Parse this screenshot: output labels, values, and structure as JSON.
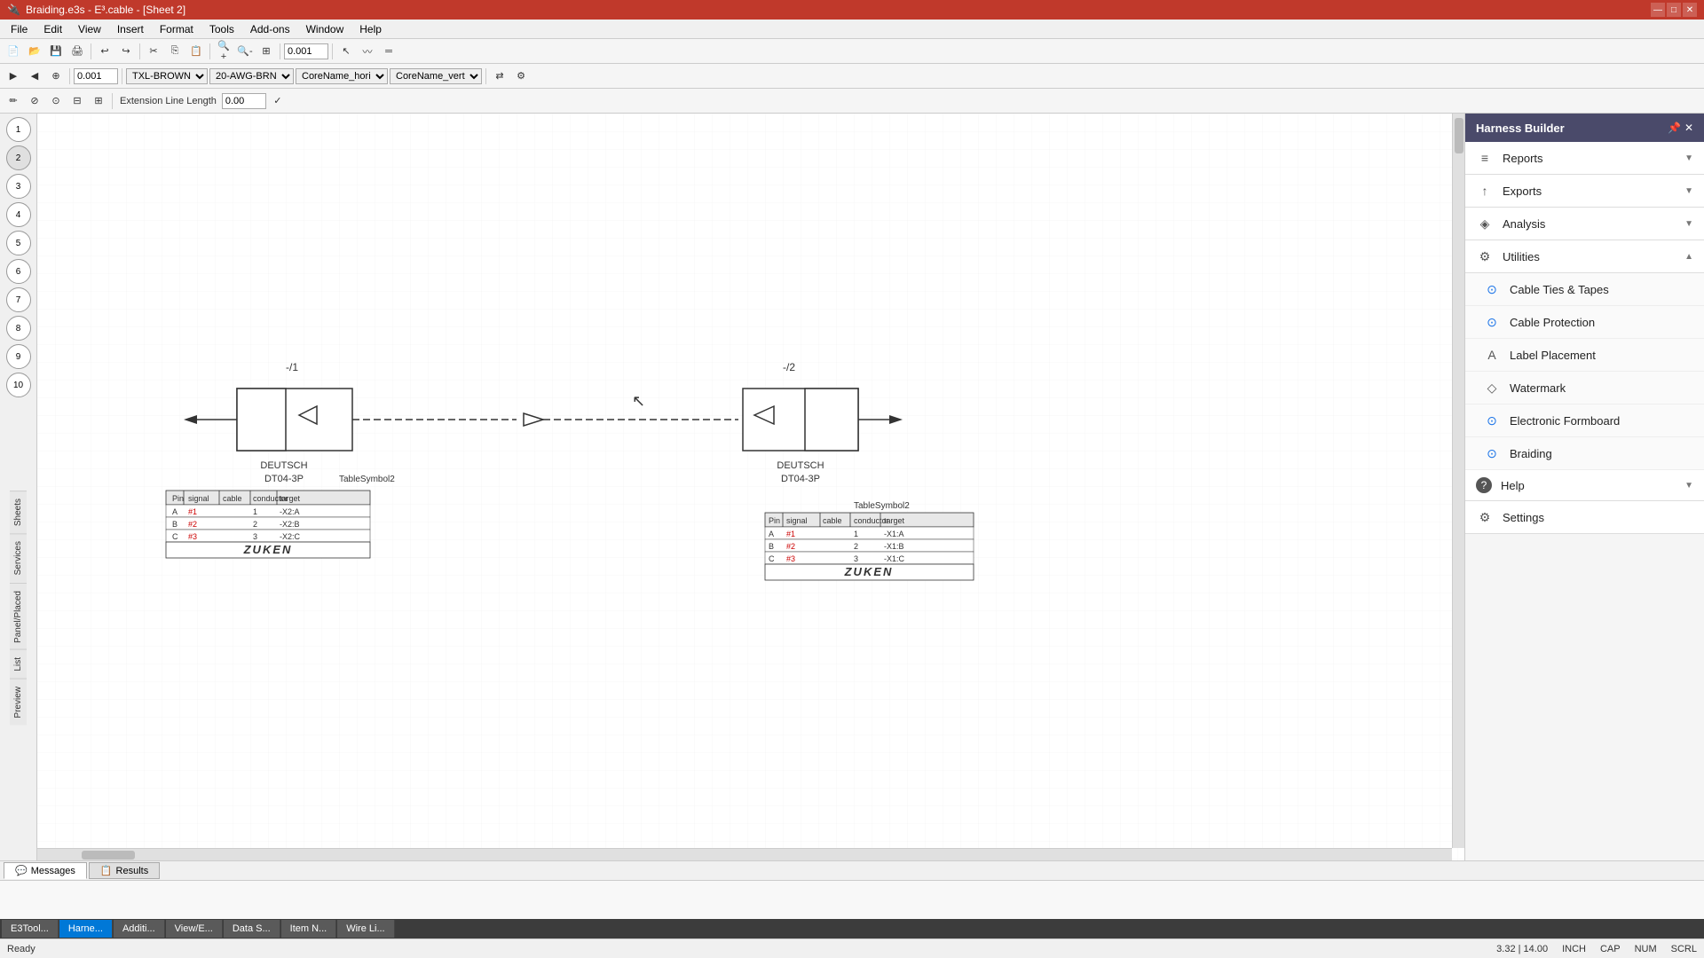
{
  "titleBar": {
    "title": "Braiding.e3s - E³.cable - [Sheet 2]",
    "controls": [
      "—",
      "□",
      "✕"
    ]
  },
  "appControls": [
    "▲",
    "✕"
  ],
  "menuBar": {
    "items": [
      "File",
      "Edit",
      "View",
      "Insert",
      "Format",
      "Tools",
      "Add-ons",
      "Window",
      "Help"
    ]
  },
  "toolbar1": {
    "items": []
  },
  "toolbar2": {
    "dropdowns": [
      "TXL-BROWN",
      "20-AWG-BRN",
      "CoreName_hori",
      "CoreName_vert"
    ]
  },
  "toolbar3": {
    "extensionLineLabel": "Extension Line Length",
    "extensionLineValue": "0.00"
  },
  "leftSidebar": {
    "tabs": [
      "Sheets",
      "Services",
      "Panel/Placed",
      "Panel Placed",
      "List",
      "Preview"
    ],
    "sheets": [
      "1",
      "2",
      "3",
      "4",
      "5",
      "6",
      "7",
      "8",
      "9",
      "10"
    ]
  },
  "canvas": {
    "connector1": {
      "label": "-/1",
      "name": "DEUTSCH",
      "model": "DT04-3P",
      "tableLabel": "TableSymbol2",
      "pins": [
        {
          "pin": "A",
          "signal": "#1",
          "cable": "",
          "conductor": "1",
          "target": "-X2:A"
        },
        {
          "pin": "B",
          "signal": "#2",
          "cable": "",
          "conductor": "2",
          "target": "-X2:B"
        },
        {
          "pin": "C",
          "signal": "#3",
          "cable": "",
          "conductor": "3",
          "target": "-X2:C"
        }
      ],
      "columns": [
        "Pin",
        "signal",
        "cable",
        "conductor",
        "target"
      ],
      "logo": "ZUKEN"
    },
    "connector2": {
      "label": "-/2",
      "name": "DEUTSCH",
      "model": "DT04-3P",
      "tableLabel": "TableSymbol2",
      "pins": [
        {
          "pin": "A",
          "signal": "#1",
          "cable": "",
          "conductor": "1",
          "target": "-X1:A"
        },
        {
          "pin": "B",
          "signal": "#2",
          "cable": "",
          "conductor": "2",
          "target": "-X1:B"
        },
        {
          "pin": "C",
          "signal": "#3",
          "cable": "",
          "conductor": "3",
          "target": "-X1:C"
        }
      ],
      "columns": [
        "Pin",
        "signal",
        "cable",
        "conductor",
        "target"
      ],
      "logo": "ZUKEN"
    }
  },
  "harnessBuilder": {
    "title": "Harness Builder",
    "items": [
      {
        "id": "reports",
        "label": "Reports",
        "icon": "≡",
        "expandable": true,
        "expanded": false
      },
      {
        "id": "exports",
        "label": "Exports",
        "icon": "↑",
        "expandable": true,
        "expanded": false
      },
      {
        "id": "analysis",
        "label": "Analysis",
        "icon": "◈",
        "expandable": true,
        "expanded": false
      },
      {
        "id": "utilities",
        "label": "Utilities",
        "icon": "⚙",
        "expandable": true,
        "expanded": true
      }
    ],
    "utilitiesSubItems": [
      {
        "id": "cable-ties",
        "label": "Cable Ties & Tapes",
        "icon": "⊙"
      },
      {
        "id": "cable-protection",
        "label": "Cable Protection",
        "icon": "⊙"
      },
      {
        "id": "label-placement",
        "label": "Label Placement",
        "icon": "A"
      },
      {
        "id": "watermark",
        "label": "Watermark",
        "icon": "◇"
      },
      {
        "id": "electronic-formboard",
        "label": "Electronic Formboard",
        "icon": "⊙"
      },
      {
        "id": "braiding",
        "label": "Braiding",
        "icon": "⊙"
      }
    ],
    "bottomItems": [
      {
        "id": "help",
        "label": "Help",
        "icon": "?",
        "expandable": true
      },
      {
        "id": "settings",
        "label": "Settings",
        "icon": "⚙",
        "expandable": false
      }
    ]
  },
  "statusBar": {
    "left": "Ready",
    "coords": "3.32 | 14.00",
    "unit": "INCH",
    "cap": "CAP",
    "num": "NUM",
    "scrl": "SCRL"
  },
  "bottomTabs": [
    {
      "id": "messages",
      "label": "Messages",
      "icon": "💬"
    },
    {
      "id": "results",
      "label": "Results",
      "icon": "📋"
    }
  ],
  "appTabs": [
    {
      "id": "e3tool",
      "label": "E3Tool...",
      "active": false
    },
    {
      "id": "harness",
      "label": "Harne...",
      "active": true
    },
    {
      "id": "additi",
      "label": "Additi...",
      "active": false
    },
    {
      "id": "viewe",
      "label": "View/E...",
      "active": false
    },
    {
      "id": "data-s",
      "label": "Data S...",
      "active": false
    },
    {
      "id": "item-n",
      "label": "Item N...",
      "active": false
    },
    {
      "id": "wire-l",
      "label": "Wire Li...",
      "active": false
    }
  ]
}
